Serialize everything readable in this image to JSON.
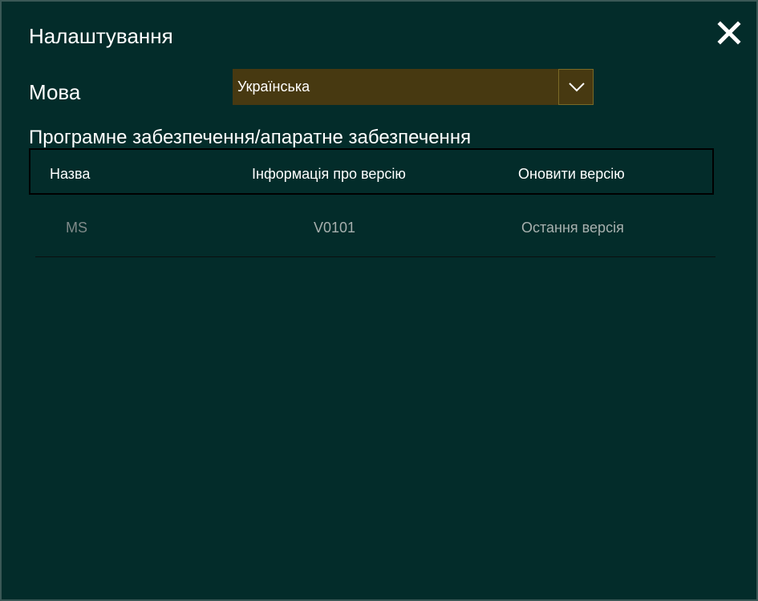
{
  "dialog": {
    "title": "Налаштування",
    "close_label": "X"
  },
  "language": {
    "label": "Мова",
    "selected": "Українська",
    "arrow_icon": "chevron-down-icon"
  },
  "section": {
    "title": "Програмне забезпечення/апаратне забезпечення"
  },
  "table": {
    "headers": [
      "Назва",
      "Інформація про версію",
      "Оновити версію"
    ],
    "rows": [
      {
        "name": "MS",
        "version": "V0101",
        "update": "Остання версія"
      }
    ]
  },
  "colors": {
    "background": "#032c2a",
    "select_background": "#473911",
    "muted_text": "#8d9a98"
  }
}
